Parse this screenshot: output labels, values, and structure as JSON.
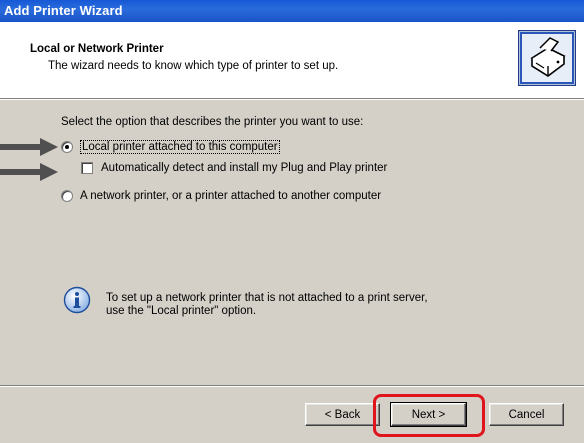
{
  "window": {
    "title": "Add Printer Wizard"
  },
  "header": {
    "title": "Local or Network Printer",
    "subtitle": "The wizard needs to know which type of printer to set up."
  },
  "main": {
    "prompt": "Select the option that describes the printer you want to use:",
    "option_local": {
      "label": "Local printer attached to this computer",
      "selected": true
    },
    "option_autodetect": {
      "label": "Automatically detect and install my Plug and Play printer",
      "checked": false
    },
    "option_network": {
      "label": "A network printer, or a printer attached to another computer",
      "selected": false
    },
    "info_line1": "To set up a network printer that is not attached to a print server,",
    "info_line2": "use the \"Local printer\" option."
  },
  "footer": {
    "back_label": "< Back",
    "next_label": "Next >",
    "cancel_label": "Cancel"
  },
  "colors": {
    "titlebar": "#1658d6",
    "highlight": "#e0141c",
    "annotation_arrow": "#505050"
  },
  "icons": [
    "printer-icon",
    "info-icon",
    "arrow-annotation-icon"
  ]
}
